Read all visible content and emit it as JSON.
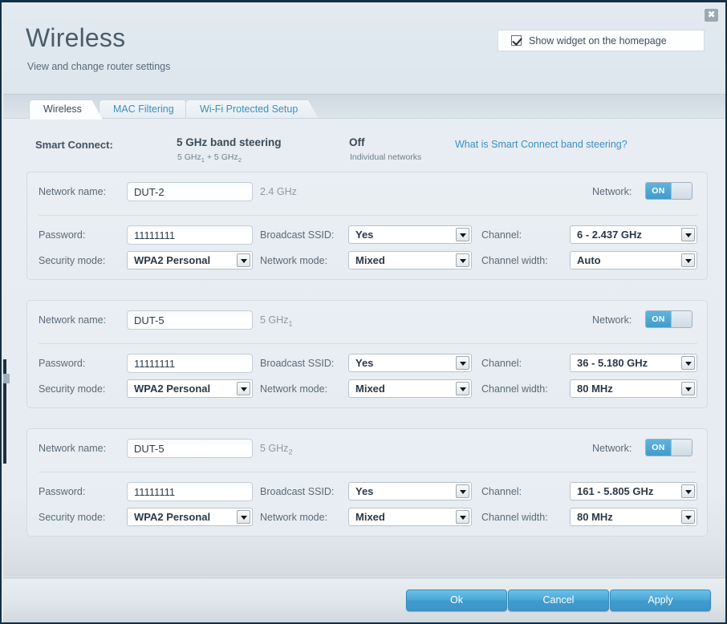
{
  "window": {
    "title": "Wireless",
    "subtitle": "View and change router settings",
    "close_icon": "close-icon"
  },
  "widget": {
    "label": "Show widget on the homepage",
    "checked": true
  },
  "tabs": [
    {
      "label": "Wireless",
      "active": true
    },
    {
      "label": "MAC Filtering",
      "active": false
    },
    {
      "label": "Wi-Fi Protected Setup",
      "active": false
    }
  ],
  "smart_connect": {
    "label": "Smart Connect:",
    "options": [
      {
        "title": "5 GHz band steering",
        "sub_prefix": "5 GHz",
        "sub_sub1": "1",
        "sub_mid": " + 5 GHz",
        "sub_sub2": "2",
        "selected": false
      },
      {
        "title": "Off",
        "sub": "Individual networks",
        "selected": true
      }
    ],
    "help_link": "What is Smart Connect band steering?"
  },
  "labels": {
    "network_name": "Network name:",
    "password": "Password:",
    "security_mode": "Security mode:",
    "broadcast_ssid": "Broadcast SSID:",
    "network_mode": "Network mode:",
    "channel": "Channel:",
    "channel_width": "Channel width:",
    "network": "Network:",
    "toggle_on": "ON"
  },
  "networks": [
    {
      "ssid": "DUT-2",
      "band": "2.4 GHz",
      "band_sub": "",
      "password": "11111111",
      "security_mode": "WPA2 Personal",
      "broadcast_ssid": "Yes",
      "network_mode": "Mixed",
      "channel": "6 - 2.437 GHz",
      "channel_width": "Auto",
      "enabled": true
    },
    {
      "ssid": "DUT-5",
      "band": "5 GHz",
      "band_sub": "1",
      "password": "11111111",
      "security_mode": "WPA2 Personal",
      "broadcast_ssid": "Yes",
      "network_mode": "Mixed",
      "channel": "36 - 5.180 GHz",
      "channel_width": "80 MHz",
      "enabled": true
    },
    {
      "ssid": "DUT-5",
      "band": "5 GHz",
      "band_sub": "2",
      "password": "11111111",
      "security_mode": "WPA2 Personal",
      "broadcast_ssid": "Yes",
      "network_mode": "Mixed",
      "channel": "161 - 5.805 GHz",
      "channel_width": "80 MHz",
      "enabled": true
    }
  ],
  "footer": {
    "ok": "Ok",
    "cancel": "Cancel",
    "apply": "Apply"
  },
  "colors": {
    "accent": "#3c8fc4",
    "toggle_on": "#4aa6d6",
    "page_bg": "#e4ebf0"
  }
}
